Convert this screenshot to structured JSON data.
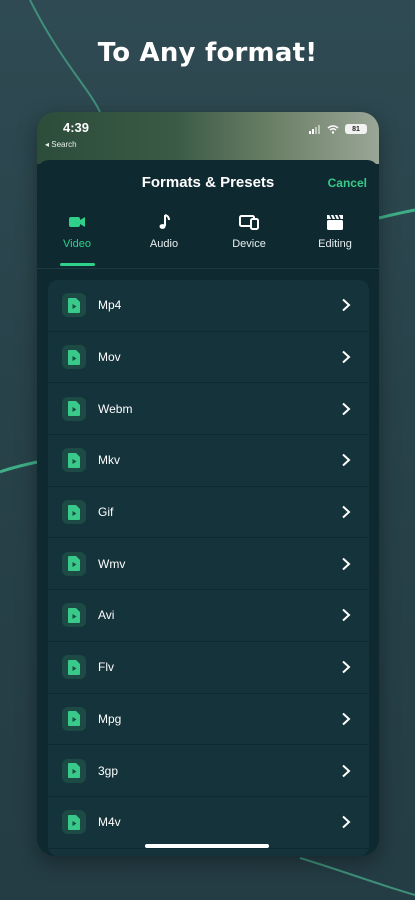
{
  "headline": "To Any format!",
  "status_bar": {
    "time": "4:39",
    "back_label": "◂ Search",
    "battery": "81"
  },
  "nav": {
    "title": "Formats & Presets",
    "cancel_label": "Cancel"
  },
  "tabs": [
    {
      "label": "Video",
      "icon": "video-camera-icon",
      "active": true
    },
    {
      "label": "Audio",
      "icon": "music-note-icon",
      "active": false
    },
    {
      "label": "Device",
      "icon": "devices-icon",
      "active": false
    },
    {
      "label": "Editing",
      "icon": "clapperboard-icon",
      "active": false
    }
  ],
  "formats": [
    {
      "label": "Mp4"
    },
    {
      "label": "Mov"
    },
    {
      "label": "Webm"
    },
    {
      "label": "Mkv"
    },
    {
      "label": "Gif"
    },
    {
      "label": "Wmv"
    },
    {
      "label": "Avi"
    },
    {
      "label": "Flv"
    },
    {
      "label": "Mpg"
    },
    {
      "label": "3gp"
    },
    {
      "label": "M4v"
    }
  ],
  "colors": {
    "accent": "#2fd08a",
    "background": "#28424a",
    "sheet": "#0e2a30",
    "list": "#15333a"
  }
}
